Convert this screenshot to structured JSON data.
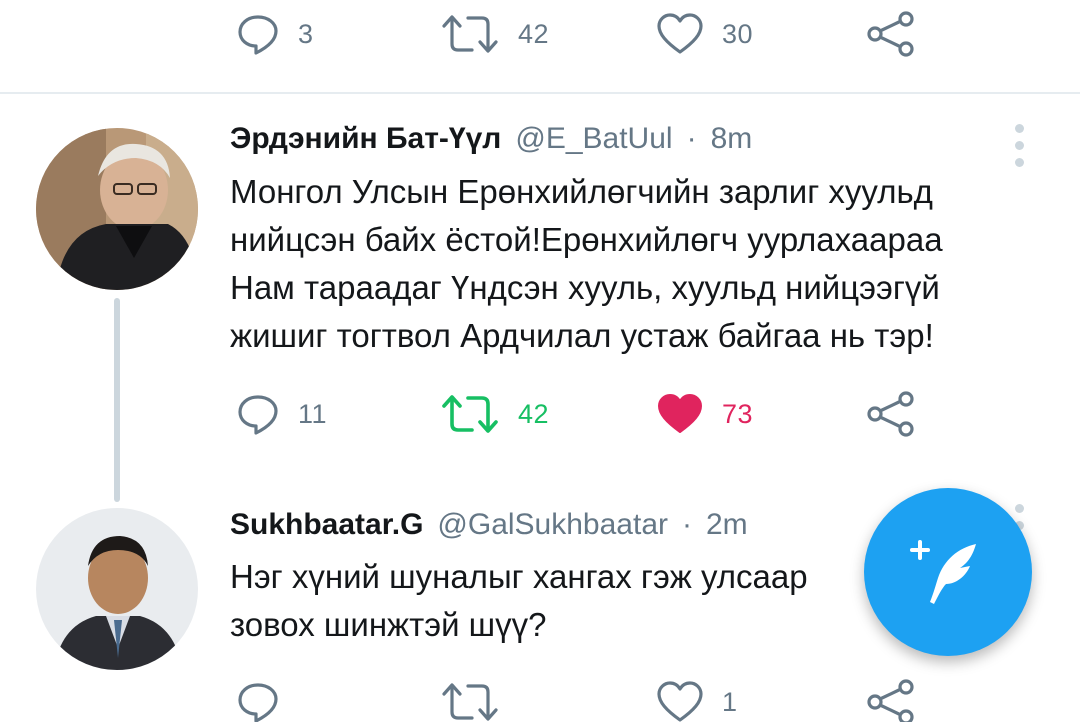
{
  "top_actions": {
    "reply_count": "3",
    "retweet_count": "42",
    "like_count": "30"
  },
  "tweets": [
    {
      "name": "Эрдэнийн Бат-Үүл",
      "handle": "@E_BatUul",
      "separator": "·",
      "time": "8m",
      "text_lines": [
        "Монгол Улсын Ерөнхийлөгчийн зарлиг хуульд",
        "нийцсэн байх ёстой!Ерөнхийлөгч уурлахаараа",
        "Нам тараадаг Үндсэн хууль, хуульд нийцээгүй",
        "жишиг тогтвол Ардчилал устаж байгаа нь тэр!"
      ],
      "reply_count": "11",
      "retweet_count": "42",
      "like_count": "73"
    },
    {
      "name": "Sukhbaatar.G",
      "handle": "@GalSukhbaatar",
      "separator": "·",
      "time": "2m",
      "text_lines": [
        "Нэг хүний шуналыг хангах гэж улсаар",
        "зовох шинжтэй шүү?"
      ],
      "like_count": "1"
    }
  ],
  "colors": {
    "accent": "#1da1f2",
    "retweet_active": "#17bf63",
    "like_active": "#e0245e",
    "muted": "#657786"
  },
  "icons": [
    "reply-icon",
    "retweet-icon",
    "like-icon",
    "share-icon",
    "more-icon",
    "compose-tweet-icon"
  ]
}
